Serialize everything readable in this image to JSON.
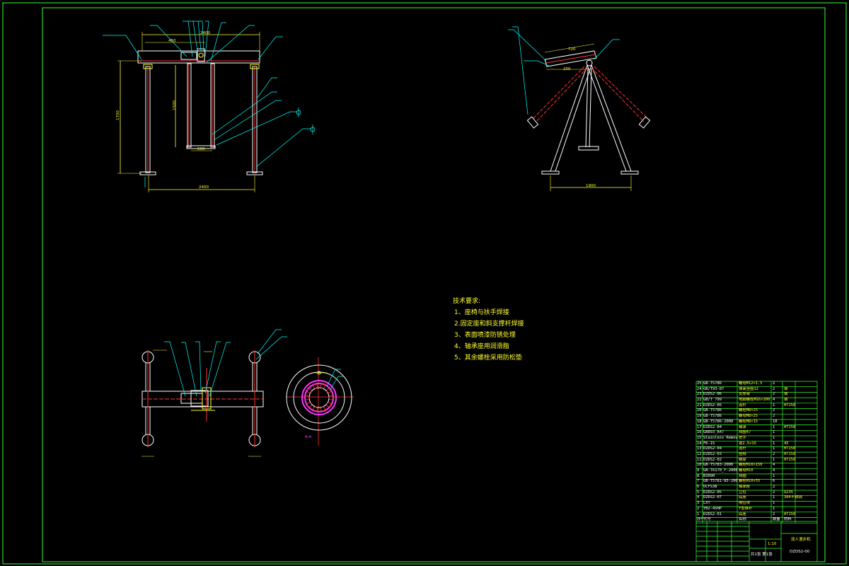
{
  "colors": {
    "background": "#000000",
    "frame": "#33ff33",
    "outline": "#ffffff",
    "dimension": "#ffff33",
    "leader": "#00ffff",
    "section": "#ff3333",
    "highlight": "#ff33ff",
    "centerline": "#ff3333"
  },
  "technical_requirements": {
    "title": "技术要求:",
    "items": [
      "1、座椅与扶手焊接",
      "2.固定座和斜支撑杆焊接",
      "3、表面喷漆防锈处理",
      "4、轴承座用润滑脂",
      "5、其余螺栓采用防松垫"
    ]
  },
  "front_view": {
    "dims": [
      "2400",
      "1700",
      "1500",
      "600",
      "450",
      "400",
      "500"
    ]
  },
  "side_view": {
    "dims": [
      "1900",
      "720",
      "200"
    ]
  },
  "section_view": {
    "label": "A-A"
  },
  "bom": {
    "header": [
      "序号",
      "代号",
      "名称",
      "数量",
      "材料"
    ],
    "rows": [
      {
        "no": "25",
        "code": "GB-T5786",
        "name": "螺母M12×1.5",
        "qty": "2",
        "mat": ""
      },
      {
        "no": "24",
        "code": "GB/T93-87",
        "name": "弹簧垫圈12",
        "qty": "2",
        "mat": "钢"
      },
      {
        "no": "23",
        "code": "DZDS2-06",
        "name": "支撑架",
        "qty": "2",
        "mat": "钢"
      },
      {
        "no": "22",
        "code": "GB/T 799",
        "name": "地脚螺栓M16×300",
        "qty": "4",
        "mat": "钢"
      },
      {
        "no": "21",
        "code": "DZDS2-05",
        "name": "连杆",
        "qty": "1",
        "mat": "HT150"
      },
      {
        "no": "20",
        "code": "GB-T5786",
        "name": "螺栓M8×25",
        "qty": "2",
        "mat": ""
      },
      {
        "no": "19",
        "code": "GB-T5786",
        "name": "螺母M8×25",
        "qty": "2",
        "mat": ""
      },
      {
        "no": "18",
        "code": "GB-T5786-2000",
        "name": "螺栓M8×15",
        "qty": "10",
        "mat": ""
      },
      {
        "no": "17",
        "code": "DZDS2-04",
        "name": "轴承",
        "qty": "1",
        "mat": "HT150"
      },
      {
        "no": "16",
        "code": "GB893_A47",
        "name": "挡圈47",
        "qty": "1",
        "mat": ""
      },
      {
        "no": "15",
        "code": "Stainless Removal",
        "name": "把手",
        "qty": "1",
        "mat": ""
      },
      {
        "no": "14",
        "code": "FK-15",
        "name": "销2.5×15",
        "qty": "1",
        "mat": "45"
      },
      {
        "no": "13",
        "code": "DZDS2-04",
        "name": "连杆",
        "qty": "1",
        "mat": "HT150"
      },
      {
        "no": "12",
        "code": "DZDS2-03",
        "name": "座椅",
        "qty": "2",
        "mat": "HT150"
      },
      {
        "no": "11",
        "code": "DZDS2-02",
        "name": "横梁",
        "qty": "1",
        "mat": "HT150"
      },
      {
        "no": "10",
        "code": "GB-T5783-2000",
        "name": "螺栓M10×150",
        "qty": "4",
        "mat": ""
      },
      {
        "no": "9",
        "code": "GB-T6170_F-2000",
        "name": "螺母M10",
        "qty": "4",
        "mat": ""
      },
      {
        "no": "8",
        "code": "B3090",
        "name": "挡圈",
        "qty": "1",
        "mat": ""
      },
      {
        "no": "7",
        "code": "GB-T5781-85-2000",
        "name": "螺栓M10×55",
        "qty": "6",
        "mat": ""
      },
      {
        "no": "6",
        "code": "UCFS38",
        "name": "轴承座",
        "qty": "2",
        "mat": ""
      },
      {
        "no": "5",
        "code": "DZDS2-05",
        "name": "立柱",
        "qty": "2",
        "mat": "Q235"
      },
      {
        "no": "4",
        "code": "DZDS2-07",
        "name": "底座",
        "qty": "1",
        "mat": "304不锈钢"
      },
      {
        "no": "3",
        "code": "LXT",
        "name": "限位块",
        "qty": "1",
        "mat": ""
      },
      {
        "no": "2",
        "code": "YBZ-45HP",
        "name": "Y型推杆",
        "qty": "1",
        "mat": ""
      },
      {
        "no": "1",
        "code": "DZDS2-01",
        "name": "底座",
        "qty": "2",
        "mat": "HT150"
      }
    ]
  },
  "title_block": {
    "drawing_name": "双人漫步机",
    "drawing_code": "DZDS2-00",
    "scale": "1:10",
    "sheet": "共1张 第1张"
  }
}
